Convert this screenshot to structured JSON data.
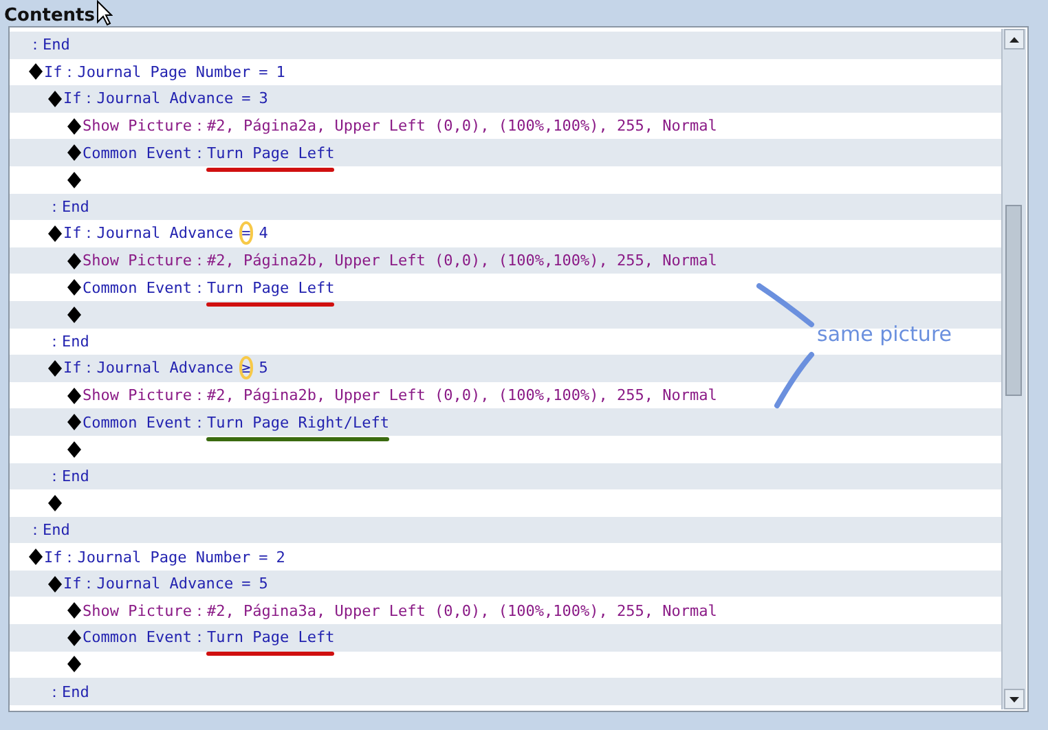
{
  "panel": {
    "title": "Contents"
  },
  "rows": [
    {
      "kind": "end",
      "text": "：End"
    },
    {
      "kind": "if",
      "command": "If：",
      "params": "Journal Page Number",
      "operator": "=",
      "operand": "1",
      "operator_circled": false,
      "children": [
        {
          "kind": "if",
          "command": "If：",
          "params": "Journal Advance",
          "operator": "=",
          "operand": "3",
          "operator_circled": false,
          "children": [
            {
              "kind": "show_picture",
              "command": "Show Picture：",
              "params": "#2, Página2a, Upper Left (0,0), (100%,100%), 255, Normal"
            },
            {
              "kind": "common_event",
              "command": "Common Event：",
              "params": "Turn Page Left",
              "color": "#d01010"
            },
            {
              "kind": "blank"
            }
          ]
        },
        {
          "kind": "end",
          "text": "：End"
        },
        {
          "kind": "if",
          "command": "If：",
          "params": "Journal Advance",
          "operator": "=",
          "operand": "4",
          "operator_circled": true,
          "children": [
            {
              "kind": "show_picture",
              "command": "Show Picture：",
              "params": "#2, Página2b, Upper Left (0,0), (100%,100%), 255, Normal"
            },
            {
              "kind": "common_event",
              "command": "Common Event：",
              "params": "Turn Page Left",
              "color": "#d01010"
            },
            {
              "kind": "blank"
            }
          ]
        },
        {
          "kind": "end",
          "text": "：End"
        },
        {
          "kind": "if",
          "command": "If：",
          "params": "Journal Advance",
          "operator": "≥",
          "operand": "5",
          "operator_circled": true,
          "children": [
            {
              "kind": "show_picture",
              "command": "Show Picture：",
              "params": "#2, Página2b, Upper Left (0,0), (100%,100%), 255, Normal"
            },
            {
              "kind": "common_event",
              "command": "Common Event：",
              "params": "Turn Page Right/Left",
              "color": "#3b6b10"
            },
            {
              "kind": "blank"
            }
          ]
        },
        {
          "kind": "end",
          "text": "：End"
        },
        {
          "kind": "blank"
        }
      ]
    },
    {
      "kind": "end",
      "text": "：End"
    },
    {
      "kind": "if",
      "command": "If：",
      "params": "Journal Page Number",
      "operator": "=",
      "operand": "2",
      "operator_circled": false,
      "children": [
        {
          "kind": "if",
          "command": "If：",
          "params": "Journal Advance",
          "operator": "=",
          "operand": "5",
          "operator_circled": false,
          "children": [
            {
              "kind": "show_picture",
              "command": "Show Picture：",
              "params": "#2, Página3a, Upper Left (0,0), (100%,100%), 255, Normal"
            },
            {
              "kind": "common_event",
              "command": "Common Event：",
              "params": "Turn Page Left",
              "color": "#d01010"
            },
            {
              "kind": "blank"
            }
          ]
        },
        {
          "kind": "end",
          "text": "：End"
        }
      ]
    }
  ],
  "annotation": {
    "text": "same picture"
  }
}
